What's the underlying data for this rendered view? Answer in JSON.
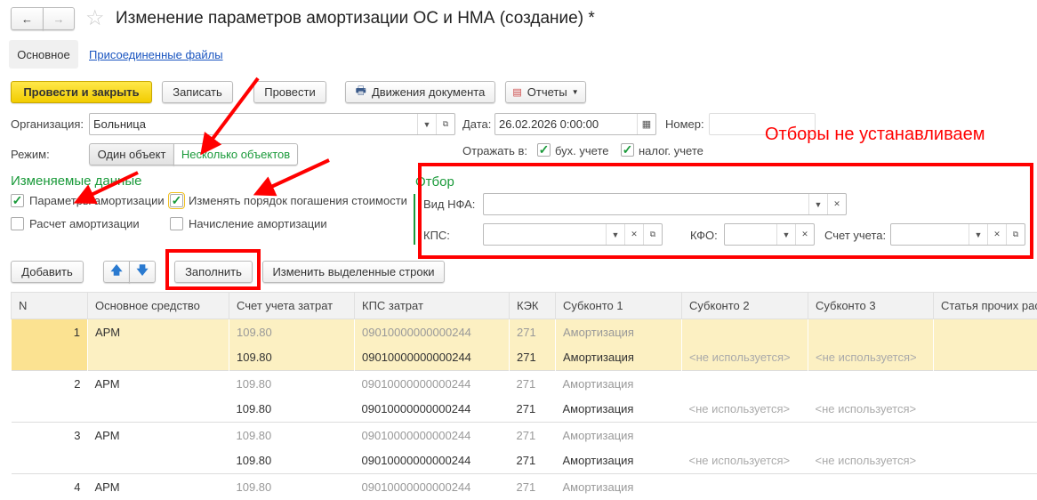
{
  "title": "Изменение параметров амортизации ОС и НМА (создание) *",
  "tabs": {
    "main": "Основное",
    "files": "Присоединенные файлы"
  },
  "toolbar": {
    "post_close": "Провести и закрыть",
    "save": "Записать",
    "post": "Провести",
    "movements": "Движения документа",
    "reports": "Отчеты"
  },
  "form": {
    "org_label": "Организация:",
    "org_value": "Больница",
    "date_label": "Дата:",
    "date_value": "26.02.2026  0:00:00",
    "number_label": "Номер:",
    "number_value": "",
    "mode_label": "Режим:",
    "mode_one": "Один объект",
    "mode_many": "Несколько объектов",
    "reflect_label": "Отражать в:",
    "acc": "бух. учете",
    "tax": "налог. учете"
  },
  "changed": {
    "title": "Изменяемые данные",
    "items": [
      {
        "label": "Параметры амортизации",
        "checked": true
      },
      {
        "label": "Изменять порядок погашения стоимости",
        "checked": true
      },
      {
        "label": "Расчет амортизации",
        "checked": false
      },
      {
        "label": "Начисление амортизации",
        "checked": false
      }
    ]
  },
  "filter": {
    "title": "Отбор",
    "nfa_label": "Вид НФА:",
    "kps_label": "КПС:",
    "kfo_label": "КФО:",
    "account_label": "Счет учета:"
  },
  "annotation": "Отборы не устанавливаем",
  "table_toolbar": {
    "add": "Добавить",
    "fill": "Заполнить",
    "edit_selected": "Изменить выделенные строки"
  },
  "table": {
    "headers": [
      "N",
      "Основное средство",
      "Счет учета затрат",
      "КПС затрат",
      "КЭК",
      "Субконто 1",
      "Субконто 2",
      "Субконто 3",
      "Статья прочих рас"
    ],
    "rows": [
      {
        "n": "1",
        "asset": "АРМ",
        "old": [
          "109.80",
          "09010000000000244",
          "271",
          "Амортизация",
          "",
          ""
        ],
        "new": [
          "109.80",
          "09010000000000244",
          "271",
          "Амортизация",
          "<не используется>",
          "<не используется>"
        ]
      },
      {
        "n": "2",
        "asset": "АРМ",
        "old": [
          "109.80",
          "09010000000000244",
          "271",
          "Амортизация",
          "",
          ""
        ],
        "new": [
          "109.80",
          "09010000000000244",
          "271",
          "Амортизация",
          "<не используется>",
          "<не используется>"
        ]
      },
      {
        "n": "3",
        "asset": "АРМ",
        "old": [
          "109.80",
          "09010000000000244",
          "271",
          "Амортизация",
          "",
          ""
        ],
        "new": [
          "109.80",
          "09010000000000244",
          "271",
          "Амортизация",
          "<не используется>",
          "<не используется>"
        ]
      },
      {
        "n": "4",
        "asset": "АРМ",
        "old": [
          "109.80",
          "09010000000000244",
          "271",
          "Амортизация",
          "",
          ""
        ],
        "new": null
      }
    ]
  }
}
